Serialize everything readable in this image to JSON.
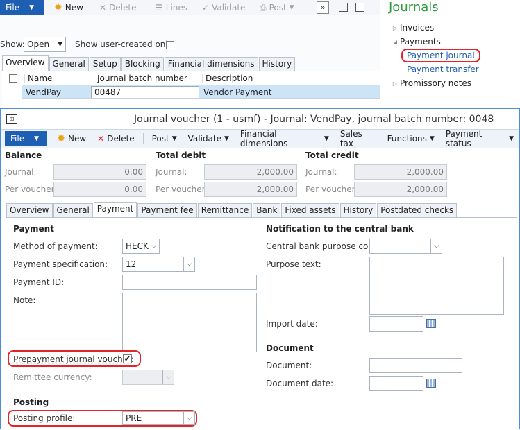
{
  "back_window": {
    "toolbar": {
      "file": "File",
      "new": "New",
      "delete": "Delete",
      "lines": "Lines",
      "validate": "Validate",
      "post": "Post"
    },
    "filter": {
      "show_label": "Show:",
      "show_value": "Open",
      "user_created_label": "Show user-created only:"
    },
    "tabs": [
      "Overview",
      "General",
      "Setup",
      "Blocking",
      "Financial dimensions",
      "History"
    ],
    "grid": {
      "headers": [
        "Name",
        "Journal batch number",
        "Description"
      ],
      "rows": [
        [
          "VendPay",
          "00487",
          "Vendor Payment"
        ]
      ]
    }
  },
  "right_pane": {
    "title": "Journals",
    "items": [
      {
        "label": "Invoices",
        "expanded": false
      },
      {
        "label": "Payments",
        "expanded": true,
        "children": [
          "Payment journal",
          "Payment transfer"
        ]
      },
      {
        "label": "Promissory notes",
        "expanded": false
      }
    ]
  },
  "front_window": {
    "title": "Journal voucher (1 - usmf) - Journal: VendPay, journal batch number: 0048",
    "toolbar": {
      "file": "File",
      "new": "New",
      "delete": "Delete",
      "post": "Post",
      "validate": "Validate",
      "financial_dimensions": "Financial dimensions",
      "sales_tax": "Sales tax",
      "functions": "Functions",
      "payment_status": "Payment status"
    },
    "balance": {
      "title": "Balance",
      "journal_label": "Journal:",
      "journal": "0.00",
      "per_voucher_label": "Per voucher:",
      "per_voucher": "0.00"
    },
    "total_debit": {
      "title": "Total debit",
      "journal_label": "Journal:",
      "journal": "2,000.00",
      "per_voucher_label": "Per voucher:",
      "per_voucher": "2,000.00"
    },
    "total_credit": {
      "title": "Total credit",
      "journal_label": "Journal:",
      "journal": "2,000.00",
      "per_voucher_label": "Per voucher:",
      "per_voucher": "2,000.00"
    },
    "tabs": [
      "Overview",
      "General",
      "Payment",
      "Payment fee",
      "Remittance",
      "Bank",
      "Fixed assets",
      "History",
      "Postdated checks"
    ],
    "payment": {
      "section": "Payment",
      "method_label": "Method of payment:",
      "method_value": "HECK",
      "spec_label": "Payment specification:",
      "spec_value": "12",
      "id_label": "Payment ID:",
      "id_value": "",
      "note_label": "Note:",
      "note_value": "",
      "prepayment_label": "Prepayment journal voucher:",
      "prepayment_checked": true,
      "remittee_label": "Remittee currency:"
    },
    "posting": {
      "section": "Posting",
      "profile_label": "Posting profile:",
      "profile_value": "PRE"
    },
    "notification": {
      "section": "Notification to the central bank",
      "purpose_code_label": "Central bank purpose code:",
      "purpose_text_label": "Purpose text:",
      "import_date_label": "Import date:"
    },
    "document": {
      "section": "Document",
      "document_label": "Document:",
      "document_date_label": "Document date:"
    }
  }
}
